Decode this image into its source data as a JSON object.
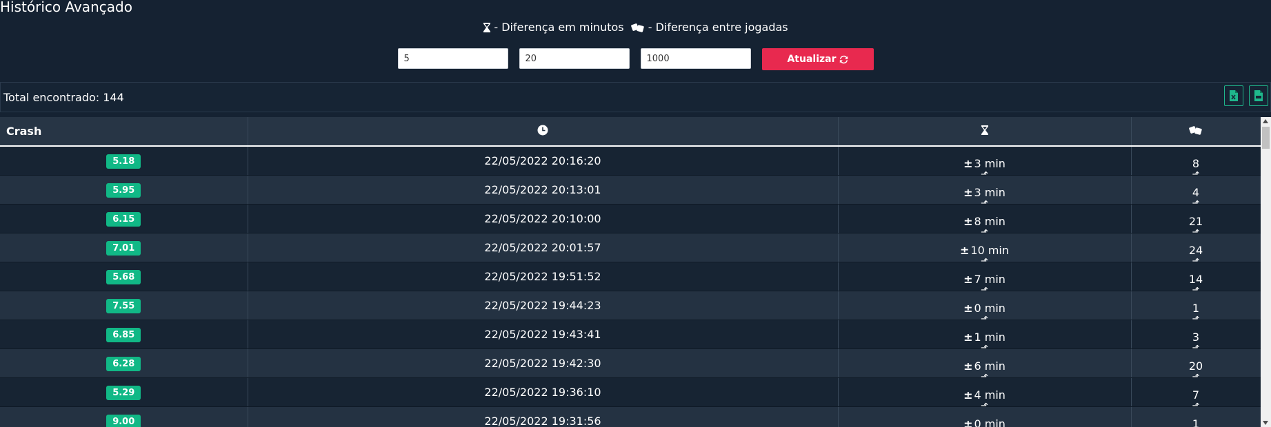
{
  "title": "Histórico Avançado",
  "legend": {
    "minutes_label": "- Diferença em minutos",
    "plays_label": "- Diferença entre jogadas"
  },
  "filters": {
    "field1_value": "5",
    "field2_value": "20",
    "field3_value": "1000",
    "update_label": "Atualizar"
  },
  "summary": {
    "total_label": "Total encontrado: 144"
  },
  "table": {
    "headers": {
      "crash": "Crash",
      "time_icon": "clock-icon",
      "minutes_icon": "hourglass-icon",
      "plays_icon": "dice-icon"
    },
    "rows": [
      {
        "crash": "5.18",
        "datetime": "22/05/2022 20:16:20",
        "minutes": "3 min",
        "plays": "8"
      },
      {
        "crash": "5.95",
        "datetime": "22/05/2022 20:13:01",
        "minutes": "3 min",
        "plays": "4"
      },
      {
        "crash": "6.15",
        "datetime": "22/05/2022 20:10:00",
        "minutes": "8 min",
        "plays": "21"
      },
      {
        "crash": "7.01",
        "datetime": "22/05/2022 20:01:57",
        "minutes": "10 min",
        "plays": "24"
      },
      {
        "crash": "5.68",
        "datetime": "22/05/2022 19:51:52",
        "minutes": "7 min",
        "plays": "14"
      },
      {
        "crash": "7.55",
        "datetime": "22/05/2022 19:44:23",
        "minutes": "0 min",
        "plays": "1"
      },
      {
        "crash": "6.85",
        "datetime": "22/05/2022 19:43:41",
        "minutes": "1 min",
        "plays": "3"
      },
      {
        "crash": "6.28",
        "datetime": "22/05/2022 19:42:30",
        "minutes": "6 min",
        "plays": "20"
      },
      {
        "crash": "5.29",
        "datetime": "22/05/2022 19:36:10",
        "minutes": "4 min",
        "plays": "7"
      },
      {
        "crash": "9.00",
        "datetime": "22/05/2022 19:31:56",
        "minutes": "0 min",
        "plays": "1"
      }
    ]
  },
  "colors": {
    "background": "#152232",
    "badge": "#11b886",
    "update_button": "#e8294f",
    "export_border": "#1fb78c"
  }
}
